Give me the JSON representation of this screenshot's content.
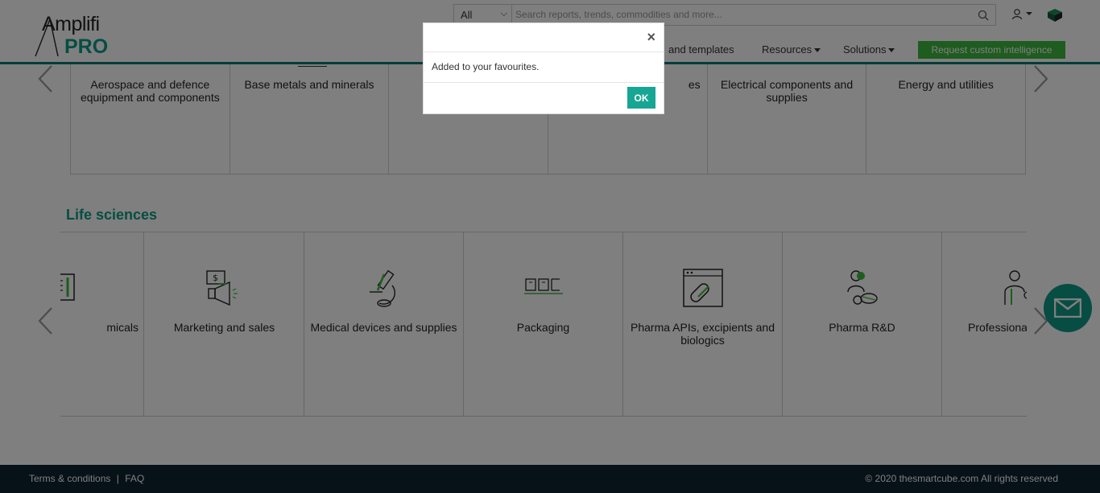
{
  "logo": {
    "line1": "Amplifi",
    "line2": "PRO"
  },
  "search": {
    "category": "All",
    "placeholder": "Search reports, trends, commodities and more..."
  },
  "nav": {
    "templates": "and templates",
    "resources": "Resources",
    "solutions": "Solutions",
    "request": "Request custom intelligence"
  },
  "top_row": [
    "Aerospace and defence equipment and components",
    "Base metals and minerals",
    "",
    "es",
    "Electrical components and supplies",
    "Energy and utilities"
  ],
  "section_title": "Life sciences",
  "life_sciences": [
    "micals",
    "Marketing and sales",
    "Medical devices and supplies",
    "Packaging",
    "Pharma APIs, excipients and biologics",
    "Pharma R&D",
    "Professiona"
  ],
  "footer": {
    "terms": "Terms & conditions",
    "sep": "|",
    "faq": "FAQ",
    "copyright": "© 2020 thesmartcube.com All rights reserved"
  },
  "modal": {
    "close": "×",
    "message": "Added to your favourites.",
    "ok": "OK"
  },
  "colors": {
    "brand": "#0f9a86",
    "request_button": "#3cb93f",
    "footer_bg": "#0d2230"
  }
}
